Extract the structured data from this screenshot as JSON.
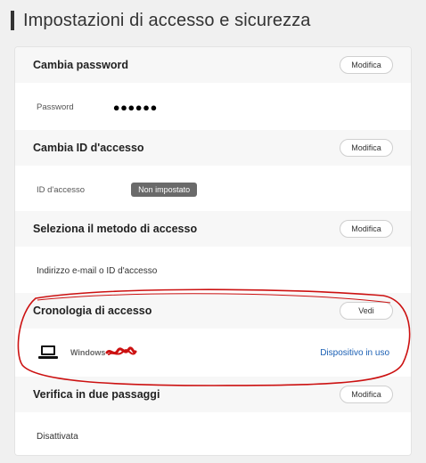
{
  "page": {
    "title": "Impostazioni di accesso e sicurezza"
  },
  "sections": {
    "password": {
      "heading": "Cambia password",
      "action_label": "Modifica",
      "field_label": "Password",
      "field_value": "●●●●●●"
    },
    "login_id": {
      "heading": "Cambia ID d'accesso",
      "action_label": "Modifica",
      "field_label": "ID d'accesso",
      "badge": "Non impostato"
    },
    "login_method": {
      "heading": "Seleziona il metodo di accesso",
      "action_label": "Modifica",
      "value": "Indirizzo e-mail o ID d'accesso"
    },
    "login_history": {
      "heading": "Cronologia di accesso",
      "action_label": "Vedi",
      "device_icon": "laptop-icon",
      "device_name": "Windows",
      "device_status": "Dispositivo in uso"
    },
    "two_step": {
      "heading": "Verifica in due passaggi",
      "action_label": "Modifica",
      "value": "Disattivata"
    }
  },
  "colors": {
    "accent_link": "#1a5fb4",
    "annotation": "#cc1111",
    "badge_bg": "#6a6a6a"
  }
}
